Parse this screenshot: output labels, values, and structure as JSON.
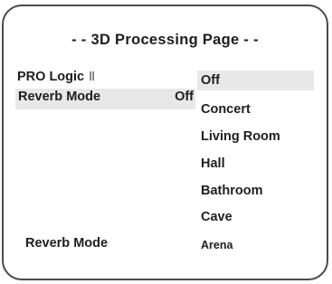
{
  "page": {
    "title": "- - 3D Processing Page - -"
  },
  "settings": {
    "pro_logic": {
      "label": "PRO Logic",
      "suffix": "II"
    },
    "reverb_mode": {
      "label": "Reverb Mode",
      "value": "Off"
    }
  },
  "reverb_options": {
    "selected": "Off",
    "items": [
      "Off",
      "Concert",
      "Living Room",
      "Hall",
      "Bathroom",
      "Cave",
      "Arena"
    ]
  },
  "footer": {
    "label": "Reverb Mode"
  },
  "colors": {
    "highlight": "#e8e8e8",
    "border": "#4a4a4a",
    "text": "#1e1e1e"
  }
}
